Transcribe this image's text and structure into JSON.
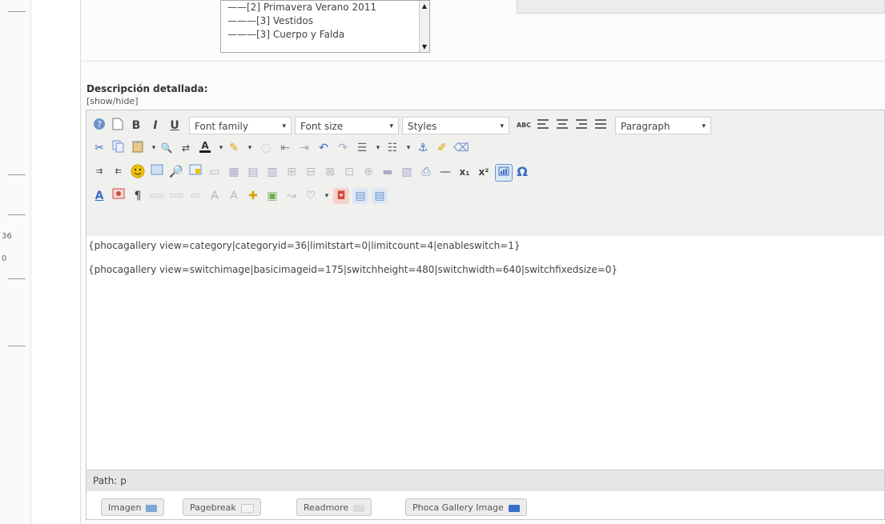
{
  "left_strip": {
    "numbers": [
      "36",
      "0"
    ]
  },
  "category_list": {
    "items": [
      "——[2] Primavera Verano 2011",
      "———[3] Vestidos",
      "———[3] Cuerpo y Falda"
    ],
    "scroll_up": "▲",
    "scroll_down": "▼"
  },
  "description": {
    "label": "Descripción detallada:",
    "toggle": "[show/hide]"
  },
  "toolbar": {
    "font_family": "Font family",
    "font_size": "Font size",
    "styles": "Styles",
    "paragraph": "Paragraph",
    "abc_label": "ABC",
    "bold_label": "B",
    "italic_label": "I",
    "underline_label": "U",
    "subscript_label": "x₁",
    "superscript_label": "x²",
    "omega_label": "Ω",
    "dropdown_arrow": "▾",
    "colors": {
      "toolbar_bg": "#f0f0ee",
      "accent_blue": "#3a6fc4",
      "icon_red": "#d34b3a",
      "icon_yellow": "#f2c200"
    }
  },
  "content": {
    "lines": [
      "{phocagallery view=category|categoryid=36|limitstart=0|limitcount=4|enableswitch=1}",
      "{phocagallery view=switchimage|basicimageid=175|switchheight=480|switchwidth=640|switchfixedsize=0}"
    ]
  },
  "status": {
    "path_label": "Path:",
    "path_value": "p"
  },
  "buttons": [
    {
      "label": "Imagen",
      "icon": "image-icon",
      "color": "#7aa9d8"
    },
    {
      "label": "Pagebreak",
      "icon": "pagebreak-icon",
      "color": "#f4f4f4"
    },
    {
      "label": "Readmore",
      "icon": "readmore-icon",
      "color": "#dcdcdc"
    },
    {
      "label": "Phoca Gallery Image",
      "icon": "phoca-icon",
      "color": "#3a6fc4"
    }
  ]
}
